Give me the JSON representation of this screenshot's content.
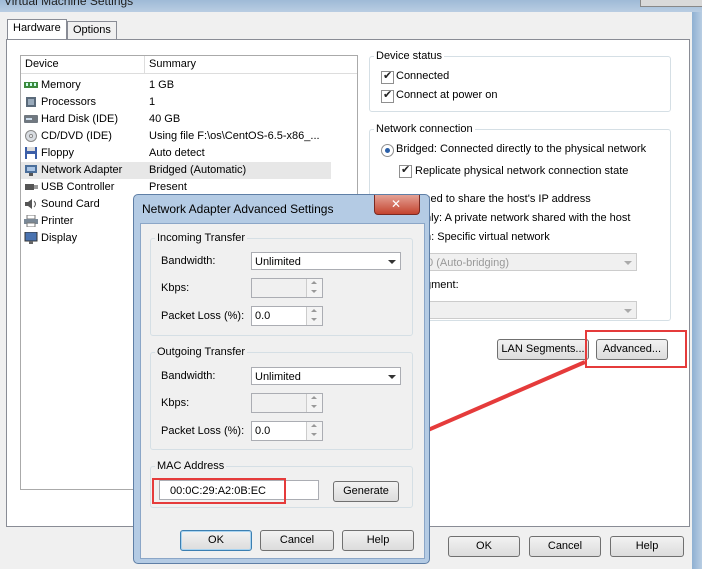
{
  "window": {
    "title": "Virtual Machine Settings"
  },
  "tabs": [
    {
      "label": "Hardware"
    },
    {
      "label": "Options"
    }
  ],
  "device_list": {
    "headers": {
      "device": "Device",
      "summary": "Summary"
    },
    "rows": [
      {
        "device": "Memory",
        "summary": "1 GB",
        "icon": "memory-icon"
      },
      {
        "device": "Processors",
        "summary": "1",
        "icon": "processor-icon"
      },
      {
        "device": "Hard Disk (IDE)",
        "summary": "40 GB",
        "icon": "hard-disk-icon"
      },
      {
        "device": "CD/DVD (IDE)",
        "summary": "Using file F:\\os\\CentOS-6.5-x86_...",
        "icon": "cd-dvd-icon"
      },
      {
        "device": "Floppy",
        "summary": "Auto detect",
        "icon": "floppy-icon"
      },
      {
        "device": "Network Adapter",
        "summary": "Bridged (Automatic)",
        "icon": "network-adapter-icon"
      },
      {
        "device": "USB Controller",
        "summary": "Present",
        "icon": "usb-icon"
      },
      {
        "device": "Sound Card",
        "summary": "",
        "icon": "sound-card-icon"
      },
      {
        "device": "Printer",
        "summary": "",
        "icon": "printer-icon"
      },
      {
        "device": "Display",
        "summary": "",
        "icon": "display-icon"
      }
    ]
  },
  "device_status": {
    "legend": "Device status",
    "connected": {
      "label": "Connected",
      "checked": true
    },
    "connect_at_power_on": {
      "label": "Connect at power on",
      "checked": true
    }
  },
  "network_connection": {
    "legend": "Network connection",
    "bridged": {
      "label": "Bridged: Connected directly to the physical network",
      "selected": true
    },
    "replicate": {
      "label": "Replicate physical network connection state",
      "checked": true
    },
    "nat_partial": "sed to share the host's IP address",
    "host_only_partial": "nly: A private network shared with the host",
    "custom_partial": "n: Specific virtual network",
    "vmnet_select": "t0 (Auto-bridging)",
    "segment_partial": "gment:",
    "lan_segments_button": "LAN Segments...",
    "advanced_button": "Advanced..."
  },
  "footer_buttons": {
    "ok": "OK",
    "cancel": "Cancel",
    "help": "Help"
  },
  "dialog": {
    "title": "Network Adapter Advanced Settings",
    "incoming": {
      "legend": "Incoming Transfer",
      "bandwidth_label": "Bandwidth:",
      "bandwidth_value": "Unlimited",
      "kbps_label": "Kbps:",
      "kbps_value": "",
      "packet_loss_label": "Packet Loss (%):",
      "packet_loss_value": "0.0"
    },
    "outgoing": {
      "legend": "Outgoing Transfer",
      "bandwidth_label": "Bandwidth:",
      "bandwidth_value": "Unlimited",
      "kbps_label": "Kbps:",
      "kbps_value": "",
      "packet_loss_label": "Packet Loss (%):",
      "packet_loss_value": "0.0"
    },
    "mac": {
      "legend": "MAC Address",
      "value": "00:0C:29:A2:0B:EC",
      "generate_button": "Generate"
    },
    "buttons": {
      "ok": "OK",
      "cancel": "Cancel",
      "help": "Help"
    }
  },
  "annotation": {
    "color": "#e53b3b"
  }
}
